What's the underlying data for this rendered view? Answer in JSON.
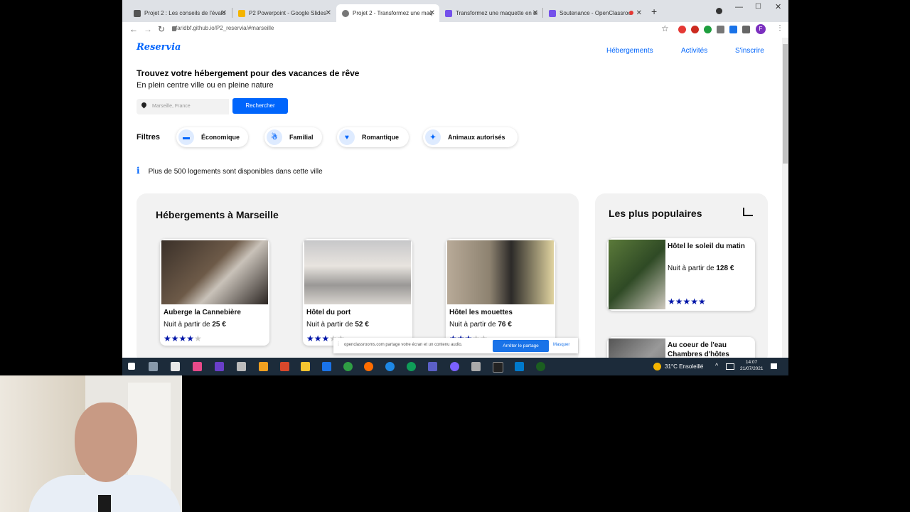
{
  "browser": {
    "tabs": [
      {
        "label": "Projet 2 : Les conseils de l'évalu",
        "color": "#555555"
      },
      {
        "label": "P2 Powerpoint - Google Slides",
        "color": "#f4b400"
      },
      {
        "label": "Projet 2 - Transformez une maq",
        "color": "#777777"
      },
      {
        "label": "Transformez une maquette en si",
        "color": "#7451eb"
      },
      {
        "label": "Soutenance - OpenClassroo",
        "color": "#7451eb"
      }
    ],
    "new_tab_icon": "+",
    "url": "faridbf.github.io/P2_reservia/#marseille",
    "profile_initial": "F"
  },
  "site": {
    "logo": "Reservia",
    "nav": {
      "hebergements": "Hébergements",
      "activites": "Activités",
      "inscrire": "S'inscrire"
    },
    "hero": {
      "title": "Trouvez votre hébergement pour des vacances de rêve",
      "subtitle": "En plein centre ville ou en pleine nature",
      "search_value": "Marseille, France",
      "search_button": "Rechercher"
    },
    "filters": {
      "label": "Filtres",
      "items": [
        "Économique",
        "Familial",
        "Romantique",
        "Animaux autorisés"
      ]
    },
    "info": "Plus de 500 logements sont disponibles dans cette ville",
    "hebergements": {
      "title": "Hébergements à Marseille",
      "cards": [
        {
          "name": "Auberge la Cannebière",
          "price_prefix": "Nuit à partir de ",
          "price": "25 €",
          "rating": 4
        },
        {
          "name": "Hôtel du port",
          "price_prefix": "Nuit à partir de ",
          "price": "52 €",
          "rating": 3
        },
        {
          "name": "Hôtel les mouettes",
          "price_prefix": "Nuit à partir de ",
          "price": "76 €",
          "rating": 3
        }
      ]
    },
    "populaires": {
      "title": "Les plus populaires",
      "cards": [
        {
          "name": "Hôtel le soleil du matin",
          "price_prefix": "Nuit à partir de ",
          "price": "128 €",
          "rating": 5
        },
        {
          "name": "Au coeur de l'eau Chambres d'hôtes"
        }
      ]
    }
  },
  "share_bar": {
    "text": "openclassrooms.com partage votre écran et un contenu audio.",
    "stop": "Arrêter le partage",
    "hide": "Masquer"
  },
  "taskbar": {
    "weather": "31°C Ensoleillé",
    "time": "14:07",
    "date": "21/07/2021"
  },
  "colors": {
    "accent": "#0065fc",
    "stars": "#0015a8",
    "panel": "#f2f2f2"
  }
}
